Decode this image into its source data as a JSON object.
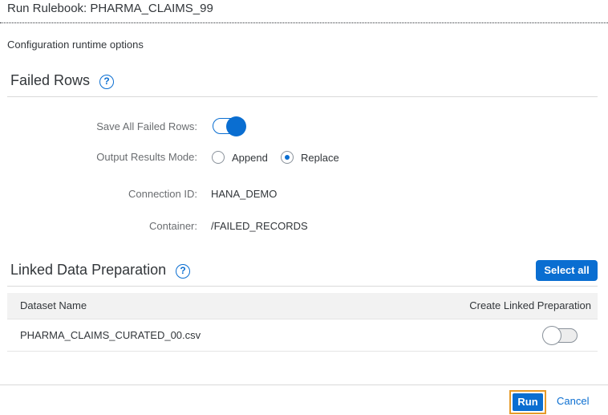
{
  "dialog": {
    "title": "Run Rulebook: PHARMA_CLAIMS_99",
    "subtitle": "Configuration runtime options"
  },
  "failed_rows": {
    "heading": "Failed Rows",
    "help_icon": "?",
    "save_label": "Save All Failed Rows:",
    "save_enabled": true,
    "output_mode_label": "Output Results Mode:",
    "output_options": [
      "Append",
      "Replace"
    ],
    "output_selected": "Replace",
    "connection_label": "Connection ID:",
    "connection_value": "HANA_DEMO",
    "container_label": "Container:",
    "container_value": "/FAILED_RECORDS"
  },
  "linked": {
    "heading": "Linked Data Preparation",
    "help_icon": "?",
    "select_all_label": "Select all",
    "columns": [
      "Dataset Name",
      "Create Linked Preparation"
    ],
    "rows": [
      {
        "dataset": "PHARMA_CLAIMS_CURATED_00.csv",
        "create": false
      }
    ]
  },
  "footer": {
    "run_label": "Run",
    "cancel_label": "Cancel"
  },
  "colors": {
    "accent": "#0a6ed1",
    "focus": "#e69a28",
    "text": "#32363a",
    "label": "#6a6d70"
  }
}
